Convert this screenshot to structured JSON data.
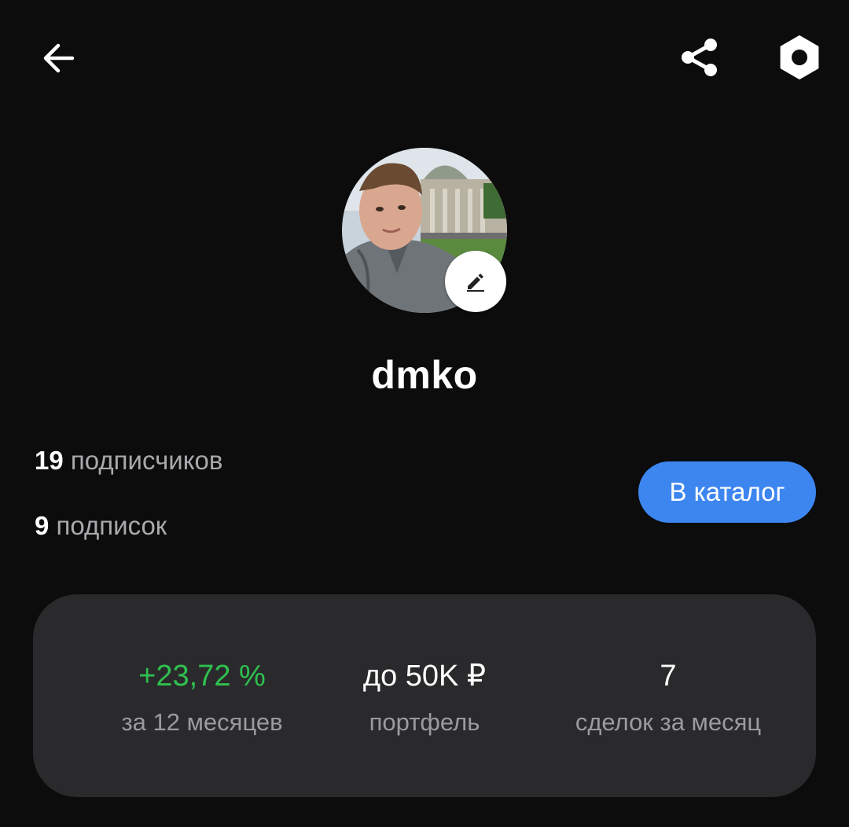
{
  "header": {
    "back_icon": "arrow-left-icon",
    "share_icon": "share-icon",
    "settings_icon": "hexagon-settings-icon"
  },
  "profile": {
    "username": "dmko",
    "avatar_icon": "user-photo",
    "edit_icon": "pencil-icon"
  },
  "social": {
    "followers_count": "19",
    "followers_label": "подписчиков",
    "following_count": "9",
    "following_label": "подписок"
  },
  "catalog_button": {
    "label": "В каталог",
    "color": "#3d86f0"
  },
  "stats": {
    "return_value": "+23,72 %",
    "return_caption": "за 12 месяцев",
    "return_color": "#2fc14f",
    "portfolio_value": "до 50K ₽",
    "portfolio_caption": "портфель",
    "deals_value": "7",
    "deals_caption": "сделок за месяц"
  }
}
